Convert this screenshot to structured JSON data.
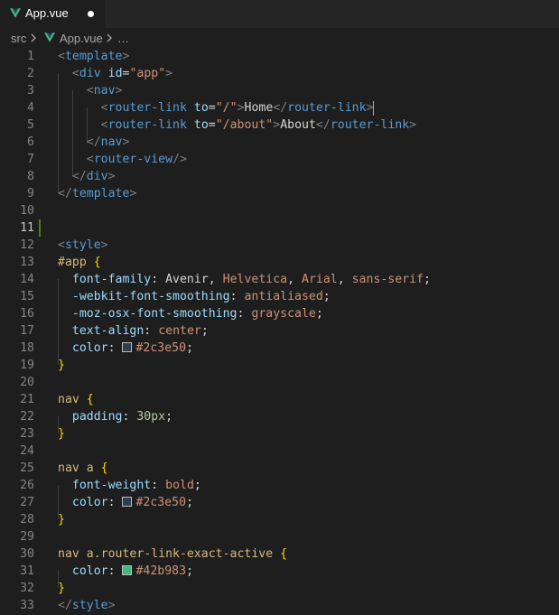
{
  "tab": {
    "title": "App.vue",
    "icon": "vue-icon",
    "state": "modified"
  },
  "breadcrumb": {
    "folder": "src",
    "file": "App.vue",
    "ellipsis": "…"
  },
  "editor": {
    "active_line": 11,
    "lines": [
      {
        "n": "1",
        "tokens": [
          [
            "punct",
            "<"
          ],
          [
            "tag",
            "template"
          ],
          [
            "punct",
            ">"
          ]
        ]
      },
      {
        "n": "2",
        "tokens": [
          [
            "text",
            "  "
          ],
          [
            "punct",
            "<"
          ],
          [
            "tag",
            "div"
          ],
          [
            "text",
            " "
          ],
          [
            "attr",
            "id"
          ],
          [
            "text",
            "="
          ],
          [
            "str",
            "\"app\""
          ],
          [
            "punct",
            ">"
          ]
        ]
      },
      {
        "n": "3",
        "tokens": [
          [
            "text",
            "    "
          ],
          [
            "punct",
            "<"
          ],
          [
            "tag",
            "nav"
          ],
          [
            "punct",
            ">"
          ]
        ]
      },
      {
        "n": "4",
        "tokens": [
          [
            "text",
            "      "
          ],
          [
            "punct",
            "<"
          ],
          [
            "tag",
            "router-link"
          ],
          [
            "text",
            " "
          ],
          [
            "attr",
            "to"
          ],
          [
            "text",
            "="
          ],
          [
            "str",
            "\"/\""
          ],
          [
            "punct",
            ">"
          ],
          [
            "text",
            "Home"
          ],
          [
            "punct",
            "</"
          ],
          [
            "tag",
            "router-link"
          ],
          [
            "punct",
            ">"
          ],
          [
            "text",
            " "
          ]
        ]
      },
      {
        "n": "5",
        "tokens": [
          [
            "text",
            "      "
          ],
          [
            "punct",
            "<"
          ],
          [
            "tag",
            "router-link"
          ],
          [
            "text",
            " "
          ],
          [
            "attr",
            "to"
          ],
          [
            "text",
            "="
          ],
          [
            "str",
            "\"/about\""
          ],
          [
            "punct",
            ">"
          ],
          [
            "text",
            "About"
          ],
          [
            "punct",
            "</"
          ],
          [
            "tag",
            "router-link"
          ],
          [
            "punct",
            ">"
          ]
        ]
      },
      {
        "n": "6",
        "tokens": [
          [
            "text",
            "    "
          ],
          [
            "punct",
            "</"
          ],
          [
            "tag",
            "nav"
          ],
          [
            "punct",
            ">"
          ]
        ]
      },
      {
        "n": "7",
        "tokens": [
          [
            "text",
            "    "
          ],
          [
            "punct",
            "<"
          ],
          [
            "tag",
            "router-view"
          ],
          [
            "punct",
            "/>"
          ]
        ]
      },
      {
        "n": "8",
        "tokens": [
          [
            "text",
            "  "
          ],
          [
            "punct",
            "</"
          ],
          [
            "tag",
            "div"
          ],
          [
            "punct",
            ">"
          ]
        ]
      },
      {
        "n": "9",
        "tokens": [
          [
            "punct",
            "</"
          ],
          [
            "tag",
            "template"
          ],
          [
            "punct",
            ">"
          ]
        ]
      },
      {
        "n": "10",
        "tokens": []
      },
      {
        "n": "11",
        "tokens": []
      },
      {
        "n": "12",
        "tokens": [
          [
            "punct",
            "<"
          ],
          [
            "tag",
            "style"
          ],
          [
            "punct",
            ">"
          ]
        ]
      },
      {
        "n": "13",
        "tokens": [
          [
            "sel",
            "#app"
          ],
          [
            "text",
            " "
          ],
          [
            "brace",
            "{"
          ]
        ]
      },
      {
        "n": "14",
        "tokens": [
          [
            "text",
            "  "
          ],
          [
            "prop",
            "font-family"
          ],
          [
            "text",
            ": Avenir, "
          ],
          [
            "val",
            "Helvetica"
          ],
          [
            "text",
            ", "
          ],
          [
            "val",
            "Arial"
          ],
          [
            "text",
            ", "
          ],
          [
            "val",
            "sans-serif"
          ],
          [
            "text",
            ";"
          ]
        ]
      },
      {
        "n": "15",
        "tokens": [
          [
            "text",
            "  "
          ],
          [
            "prop",
            "-webkit-font-smoothing"
          ],
          [
            "text",
            ": "
          ],
          [
            "val",
            "antialiased"
          ],
          [
            "text",
            ";"
          ]
        ]
      },
      {
        "n": "16",
        "tokens": [
          [
            "text",
            "  "
          ],
          [
            "prop",
            "-moz-osx-font-smoothing"
          ],
          [
            "text",
            ": "
          ],
          [
            "val",
            "grayscale"
          ],
          [
            "text",
            ";"
          ]
        ]
      },
      {
        "n": "17",
        "tokens": [
          [
            "text",
            "  "
          ],
          [
            "prop",
            "text-align"
          ],
          [
            "text",
            ": "
          ],
          [
            "val",
            "center"
          ],
          [
            "text",
            ";"
          ]
        ]
      },
      {
        "n": "18",
        "tokens": [
          [
            "text",
            "  "
          ],
          [
            "prop",
            "color"
          ],
          [
            "text",
            ": "
          ],
          [
            "swatch",
            "#2c3e50"
          ],
          [
            "val",
            "#2c3e50"
          ],
          [
            "text",
            ";"
          ]
        ]
      },
      {
        "n": "19",
        "tokens": [
          [
            "brace",
            "}"
          ]
        ]
      },
      {
        "n": "20",
        "tokens": []
      },
      {
        "n": "21",
        "tokens": [
          [
            "sel",
            "nav"
          ],
          [
            "text",
            " "
          ],
          [
            "brace",
            "{"
          ]
        ]
      },
      {
        "n": "22",
        "tokens": [
          [
            "text",
            "  "
          ],
          [
            "prop",
            "padding"
          ],
          [
            "text",
            ": "
          ],
          [
            "num",
            "30px"
          ],
          [
            "text",
            ";"
          ]
        ]
      },
      {
        "n": "23",
        "tokens": [
          [
            "brace",
            "}"
          ]
        ]
      },
      {
        "n": "24",
        "tokens": []
      },
      {
        "n": "25",
        "tokens": [
          [
            "sel",
            "nav a"
          ],
          [
            "text",
            " "
          ],
          [
            "brace",
            "{"
          ]
        ]
      },
      {
        "n": "26",
        "tokens": [
          [
            "text",
            "  "
          ],
          [
            "prop",
            "font-weight"
          ],
          [
            "text",
            ": "
          ],
          [
            "val",
            "bold"
          ],
          [
            "text",
            ";"
          ]
        ]
      },
      {
        "n": "27",
        "tokens": [
          [
            "text",
            "  "
          ],
          [
            "prop",
            "color"
          ],
          [
            "text",
            ": "
          ],
          [
            "swatch",
            "#2c3e50"
          ],
          [
            "val",
            "#2c3e50"
          ],
          [
            "text",
            ";"
          ]
        ]
      },
      {
        "n": "28",
        "tokens": [
          [
            "brace",
            "}"
          ]
        ]
      },
      {
        "n": "29",
        "tokens": []
      },
      {
        "n": "30",
        "tokens": [
          [
            "sel",
            "nav a.router-link-exact-active"
          ],
          [
            "text",
            " "
          ],
          [
            "brace",
            "{"
          ]
        ]
      },
      {
        "n": "31",
        "tokens": [
          [
            "text",
            "  "
          ],
          [
            "prop",
            "color"
          ],
          [
            "text",
            ": "
          ],
          [
            "swatch",
            "#42b983"
          ],
          [
            "val",
            "#42b983"
          ],
          [
            "text",
            ";"
          ]
        ]
      },
      {
        "n": "32",
        "tokens": [
          [
            "brace",
            "}"
          ]
        ]
      },
      {
        "n": "33",
        "tokens": [
          [
            "punct",
            "</"
          ],
          [
            "tag",
            "style"
          ],
          [
            "punct",
            ">"
          ]
        ]
      }
    ]
  },
  "colors": {
    "background": "#1e1e1e",
    "tab_bar": "#252526",
    "vue_green": "#41b883",
    "vue_dark": "#35495e",
    "added_line_marker": "#587c0c"
  }
}
